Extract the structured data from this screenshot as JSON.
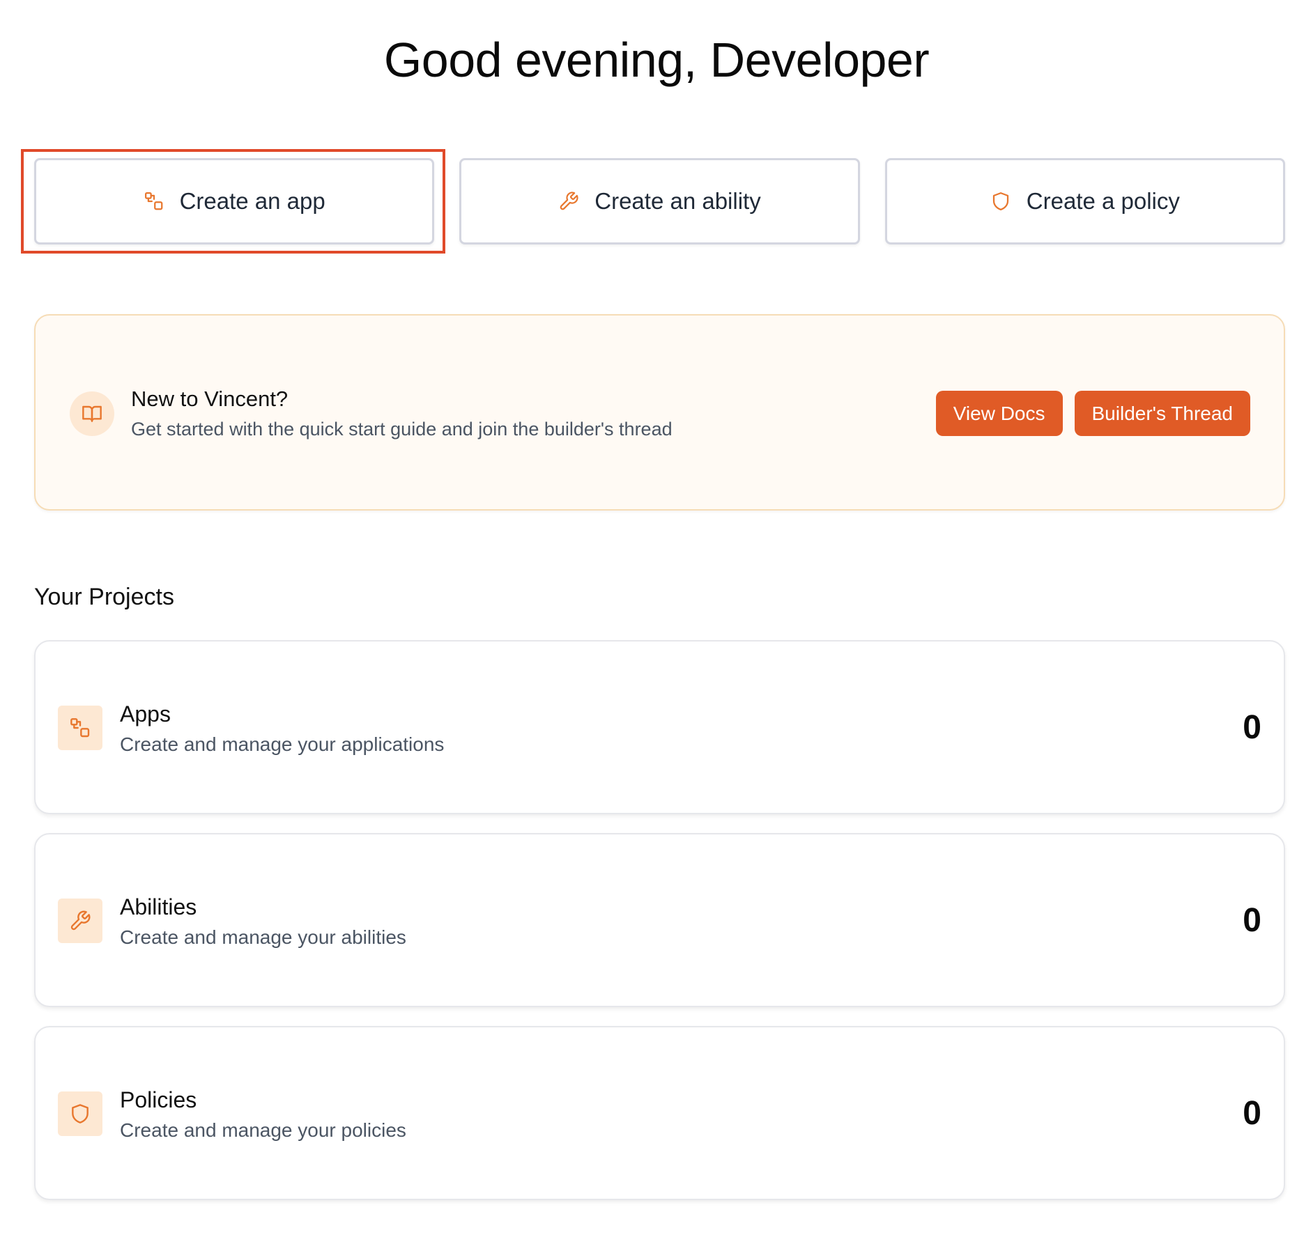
{
  "greeting": "Good evening, Developer",
  "actions": [
    {
      "label": "Create an app",
      "icon": "apps-icon"
    },
    {
      "label": "Create an ability",
      "icon": "wrench-icon"
    },
    {
      "label": "Create a policy",
      "icon": "shield-icon"
    }
  ],
  "banner": {
    "title": "New to Vincent?",
    "subtitle": "Get started with the quick start guide and join the builder's thread",
    "icon": "book-icon",
    "buttons": {
      "docs": "View Docs",
      "thread": "Builder's Thread"
    }
  },
  "projects": {
    "title": "Your Projects",
    "items": [
      {
        "name": "Apps",
        "description": "Create and manage your applications",
        "count": "0",
        "icon": "apps-icon"
      },
      {
        "name": "Abilities",
        "description": "Create and manage your abilities",
        "count": "0",
        "icon": "wrench-icon"
      },
      {
        "name": "Policies",
        "description": "Create and manage your policies",
        "count": "0",
        "icon": "shield-icon"
      }
    ]
  },
  "colors": {
    "accent": "#e05b26",
    "highlight": "#e04a2a",
    "icon_bg": "#fde8d3",
    "banner_bg": "#fffaf4"
  }
}
